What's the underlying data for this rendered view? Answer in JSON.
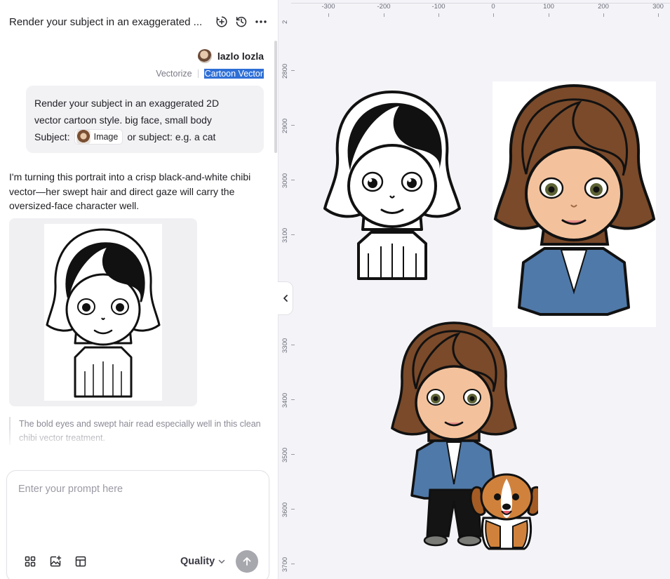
{
  "header": {
    "title": "Render your subject in an exaggerated ..."
  },
  "user": {
    "name": "lazlo lozla"
  },
  "tags": {
    "vectorize": "Vectorize",
    "cartoon_vector": "Cartoon Vector"
  },
  "prompt": {
    "line1": "Render your subject in an exaggerated 2D",
    "line2": "vector cartoon style. big face, small body",
    "subject_label": "Subject:",
    "image_chip": "Image",
    "or_subject": "or subject: e.g. a cat"
  },
  "reply": {
    "text": "I'm turning this portrait into a crisp black-and-white chibi vector—her swept hair and direct gaze will carry the oversized-face character well."
  },
  "note": {
    "text": "The bold eyes and swept hair read especially well in this clean chibi vector treatment."
  },
  "input": {
    "placeholder": "Enter your prompt here",
    "quality_label": "Quality"
  },
  "ruler": {
    "top_ticks": [
      "-300",
      "-200",
      "-100",
      "0",
      "100",
      "200",
      "300"
    ],
    "left_ticks": [
      "2",
      "2800",
      "2900",
      "3000",
      "3100",
      "3300",
      "3400",
      "3500",
      "3600",
      "3700"
    ]
  },
  "icons": {
    "header": [
      "new-chat-icon",
      "history-icon",
      "more-icon"
    ],
    "toolbar": [
      "grid-icon",
      "add-image-icon",
      "layout-icon"
    ],
    "send": "arrow-up-icon",
    "collapse": "chevron-left-icon"
  },
  "colors": {
    "accent_selection": "#2f6fd6",
    "canvas_bg": "#f4f4f8",
    "send_button": "#a7a7ae"
  }
}
